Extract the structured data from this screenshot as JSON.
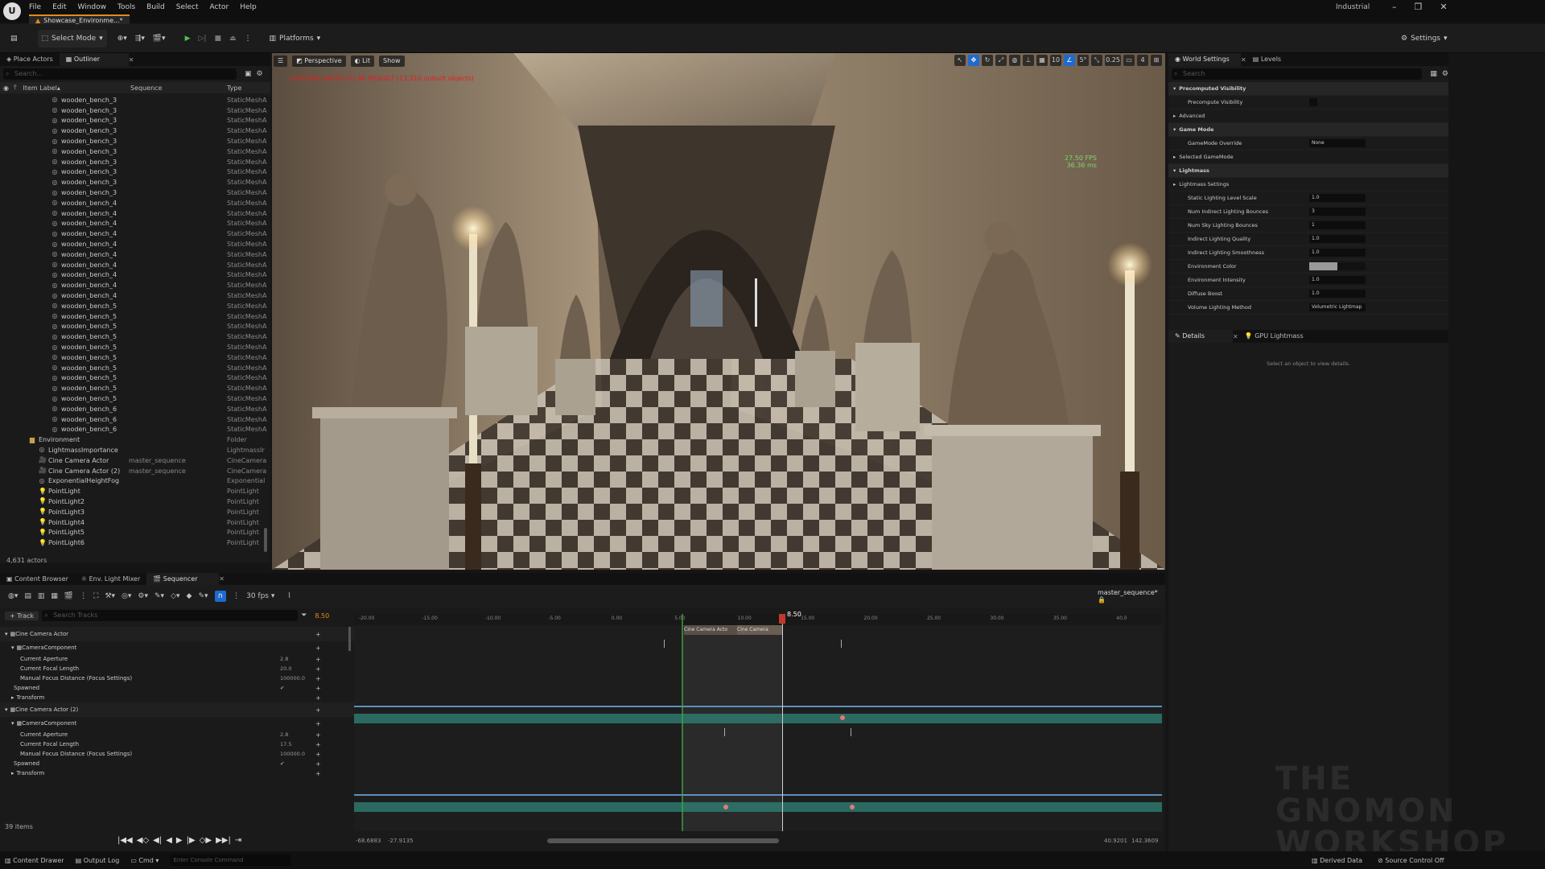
{
  "app": {
    "logo": "U",
    "project": "Industrial",
    "doc_tab": "Showcase_Environme...*"
  },
  "menu": [
    "File",
    "Edit",
    "Window",
    "Tools",
    "Build",
    "Select",
    "Actor",
    "Help"
  ],
  "toolbar": {
    "select_mode": "Select Mode",
    "platforms": "Platforms",
    "settings": "Settings"
  },
  "outliner": {
    "tabs": [
      "Place Actors",
      "Outliner"
    ],
    "search_placeholder": "Search...",
    "columns": [
      "Item Label",
      "Sequence",
      "Type"
    ],
    "rows": [
      {
        "name": "wooden_bench_3",
        "type": "StaticMeshA",
        "seq": ""
      },
      {
        "name": "wooden_bench_3",
        "type": "StaticMeshA",
        "seq": ""
      },
      {
        "name": "wooden_bench_3",
        "type": "StaticMeshA",
        "seq": ""
      },
      {
        "name": "wooden_bench_3",
        "type": "StaticMeshA",
        "seq": ""
      },
      {
        "name": "wooden_bench_3",
        "type": "StaticMeshA",
        "seq": ""
      },
      {
        "name": "wooden_bench_3",
        "type": "StaticMeshA",
        "seq": ""
      },
      {
        "name": "wooden_bench_3",
        "type": "StaticMeshA",
        "seq": ""
      },
      {
        "name": "wooden_bench_3",
        "type": "StaticMeshA",
        "seq": ""
      },
      {
        "name": "wooden_bench_3",
        "type": "StaticMeshA",
        "seq": ""
      },
      {
        "name": "wooden_bench_3",
        "type": "StaticMeshA",
        "seq": ""
      },
      {
        "name": "wooden_bench_4",
        "type": "StaticMeshA",
        "seq": ""
      },
      {
        "name": "wooden_bench_4",
        "type": "StaticMeshA",
        "seq": ""
      },
      {
        "name": "wooden_bench_4",
        "type": "StaticMeshA",
        "seq": ""
      },
      {
        "name": "wooden_bench_4",
        "type": "StaticMeshA",
        "seq": ""
      },
      {
        "name": "wooden_bench_4",
        "type": "StaticMeshA",
        "seq": ""
      },
      {
        "name": "wooden_bench_4",
        "type": "StaticMeshA",
        "seq": ""
      },
      {
        "name": "wooden_bench_4",
        "type": "StaticMeshA",
        "seq": ""
      },
      {
        "name": "wooden_bench_4",
        "type": "StaticMeshA",
        "seq": ""
      },
      {
        "name": "wooden_bench_4",
        "type": "StaticMeshA",
        "seq": ""
      },
      {
        "name": "wooden_bench_4",
        "type": "StaticMeshA",
        "seq": ""
      },
      {
        "name": "wooden_bench_5",
        "type": "StaticMeshA",
        "seq": ""
      },
      {
        "name": "wooden_bench_5",
        "type": "StaticMeshA",
        "seq": ""
      },
      {
        "name": "wooden_bench_5",
        "type": "StaticMeshA",
        "seq": ""
      },
      {
        "name": "wooden_bench_5",
        "type": "StaticMeshA",
        "seq": ""
      },
      {
        "name": "wooden_bench_5",
        "type": "StaticMeshA",
        "seq": ""
      },
      {
        "name": "wooden_bench_5",
        "type": "StaticMeshA",
        "seq": ""
      },
      {
        "name": "wooden_bench_5",
        "type": "StaticMeshA",
        "seq": ""
      },
      {
        "name": "wooden_bench_5",
        "type": "StaticMeshA",
        "seq": ""
      },
      {
        "name": "wooden_bench_5",
        "type": "StaticMeshA",
        "seq": ""
      },
      {
        "name": "wooden_bench_5",
        "type": "StaticMeshA",
        "seq": ""
      },
      {
        "name": "wooden_bench_6",
        "type": "StaticMeshA",
        "seq": ""
      },
      {
        "name": "wooden_bench_6",
        "type": "StaticMeshA",
        "seq": ""
      },
      {
        "name": "wooden_bench_6",
        "type": "StaticMeshA",
        "seq": ""
      },
      {
        "name": "Environment",
        "type": "Folder",
        "seq": "",
        "folder": true
      },
      {
        "name": "LightmassImportance",
        "type": "LightmassIr",
        "seq": ""
      },
      {
        "name": "Cine Camera Actor",
        "type": "CineCamera",
        "seq": "master_sequence"
      },
      {
        "name": "Cine Camera Actor (2)",
        "type": "CineCamera",
        "seq": "master_sequence"
      },
      {
        "name": "ExponentialHeightFog",
        "type": "Exponential",
        "seq": ""
      },
      {
        "name": "PointLight",
        "type": "PointLight",
        "seq": ""
      },
      {
        "name": "PointLight2",
        "type": "PointLight",
        "seq": ""
      },
      {
        "name": "PointLight3",
        "type": "PointLight",
        "seq": ""
      },
      {
        "name": "PointLight4",
        "type": "PointLight",
        "seq": ""
      },
      {
        "name": "PointLight5",
        "type": "PointLight",
        "seq": ""
      },
      {
        "name": "PointLight6",
        "type": "PointLight",
        "seq": ""
      }
    ],
    "count": "4,631 actors"
  },
  "viewport": {
    "perspective": "Perspective",
    "lit": "Lit",
    "show": "Show",
    "warning": "LIGHTING NEEDS TO BE REBUILT (13,310 unbuilt objects)",
    "fps": "27.50 FPS",
    "ms": "36.36 ms",
    "snap1": "10",
    "snap2": "5°",
    "snap3": "0.25",
    "snap4": "4"
  },
  "world": {
    "tabs": [
      "World Settings",
      "Levels"
    ],
    "search_placeholder": "Search",
    "rows": [
      {
        "label": "Precomputed Visibility",
        "cat": true
      },
      {
        "label": "Precompute Visibility",
        "val": ""
      },
      {
        "label": "Advanced",
        "cat": false,
        "sub": true
      },
      {
        "label": "Game Mode",
        "cat": true
      },
      {
        "label": "GameMode Override",
        "val": "None"
      },
      {
        "label": "Selected GameMode",
        "sub": true
      },
      {
        "label": "Lightmass",
        "cat": true
      },
      {
        "label": "Lightmass Settings",
        "sub": true
      },
      {
        "label": "Static Lighting Level Scale",
        "val": "1.0"
      },
      {
        "label": "Num Indirect Lighting Bounces",
        "val": "3"
      },
      {
        "label": "Num Sky Lighting Bounces",
        "val": "1"
      },
      {
        "label": "Indirect Lighting Quality",
        "val": "1.0"
      },
      {
        "label": "Indirect Lighting Smoothness",
        "val": "1.0"
      },
      {
        "label": "Environment Color",
        "val": ""
      },
      {
        "label": "Environment Intensity",
        "val": "1.0"
      },
      {
        "label": "Diffuse Boost",
        "val": "1.0"
      },
      {
        "label": "Volume Lighting Method",
        "val": "Volumetric Lightmap"
      }
    ]
  },
  "details": {
    "tabs": [
      "Details",
      "GPU Lightmass"
    ],
    "message": "Select an object to view details."
  },
  "bottom_tabs": [
    "Content Browser",
    "Env. Light Mixer",
    "Sequencer"
  ],
  "sequencer": {
    "fps": "30 fps",
    "seq_name": "master_sequence*",
    "add_track": "Track",
    "search_placeholder": "Search Tracks",
    "current_time": "8.50",
    "playhead": "8.50",
    "ruler": [
      "-20.00",
      "-15.00",
      "-10.00",
      "-5.00",
      "0.00",
      "5.00",
      "10.00",
      "15.00",
      "20.00",
      "25.00",
      "30.00",
      "35.00",
      "40.0"
    ],
    "tracks": [
      {
        "label": "Cine Camera Actor",
        "lvl": 0,
        "val": ""
      },
      {
        "label": "CameraComponent",
        "lvl": 1,
        "val": ""
      },
      {
        "label": "Current Aperture",
        "lvl": 2,
        "val": "2.8"
      },
      {
        "label": "Current Focal Length",
        "lvl": 2,
        "val": "20.0"
      },
      {
        "label": "Manual Focus Distance (Focus Settings)",
        "lvl": 2,
        "val": "100000.0"
      },
      {
        "label": "Spawned",
        "lvl": 1,
        "val": "✔"
      },
      {
        "label": "Transform",
        "lvl": 1,
        "val": ""
      },
      {
        "label": "Cine Camera Actor (2)",
        "lvl": 0,
        "val": ""
      },
      {
        "label": "CameraComponent",
        "lvl": 1,
        "val": ""
      },
      {
        "label": "Current Aperture",
        "lvl": 2,
        "val": "2.8"
      },
      {
        "label": "Current Focal Length",
        "lvl": 2,
        "val": "17.5"
      },
      {
        "label": "Manual Focus Distance (Focus Settings)",
        "lvl": 2,
        "val": "100000.0"
      },
      {
        "label": "Spawned",
        "lvl": 1,
        "val": "✔"
      },
      {
        "label": "Transform",
        "lvl": 1,
        "val": ""
      }
    ],
    "items": "39 items",
    "range_left": "-68.6883",
    "range_left2": "-27.9135",
    "range_right": "40.9201",
    "range_right2": "142.3609",
    "shot1": "Cine Camera Acto",
    "shot2": "Cine Camera"
  },
  "status": {
    "content_drawer": "Content Drawer",
    "output_log": "Output Log",
    "cmd": "Cmd",
    "console_placeholder": "Enter Console Command",
    "derived": "Derived Data",
    "source": "Source Control Off"
  },
  "watermark": "THE GNOMON WORKSHOP",
  "colors": {
    "accent": "#e48a1a",
    "select": "#1f6ad0",
    "track_green": "#2f7e72"
  }
}
